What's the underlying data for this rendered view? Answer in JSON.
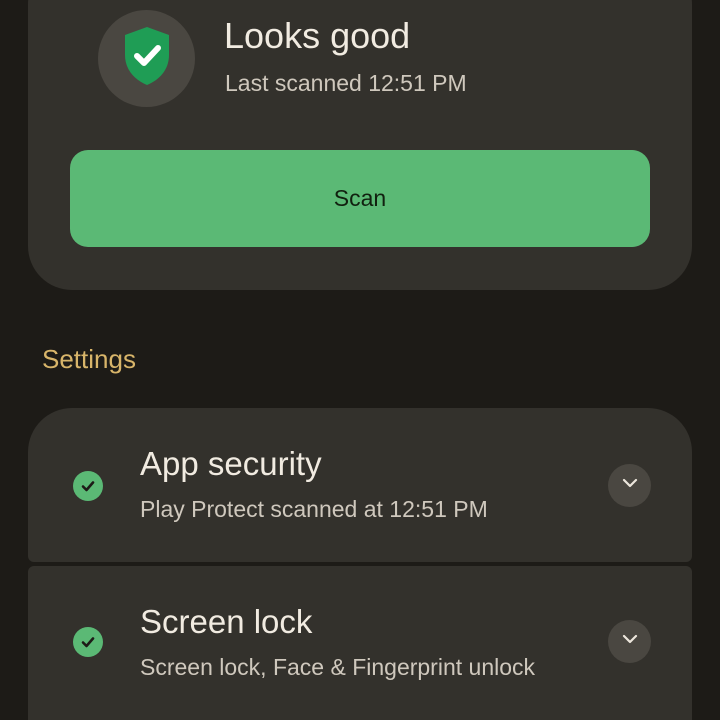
{
  "status": {
    "title": "Looks good",
    "subtitle": "Last scanned 12:51 PM",
    "icon": "shield-check-icon",
    "shield_color": "#1f9d55",
    "scan_button_label": "Scan",
    "scan_button_color": "#5bb975"
  },
  "settings": {
    "heading": "Settings",
    "heading_color": "#d8b56a",
    "items": [
      {
        "title": "App security",
        "subtitle": "Play Protect scanned at 12:51 PM",
        "status_icon": "check-circle-icon",
        "expand_icon": "chevron-down-icon"
      },
      {
        "title": "Screen lock",
        "subtitle": "Screen lock, Face & Fingerprint unlock",
        "status_icon": "check-circle-icon",
        "expand_icon": "chevron-down-icon"
      }
    ]
  }
}
